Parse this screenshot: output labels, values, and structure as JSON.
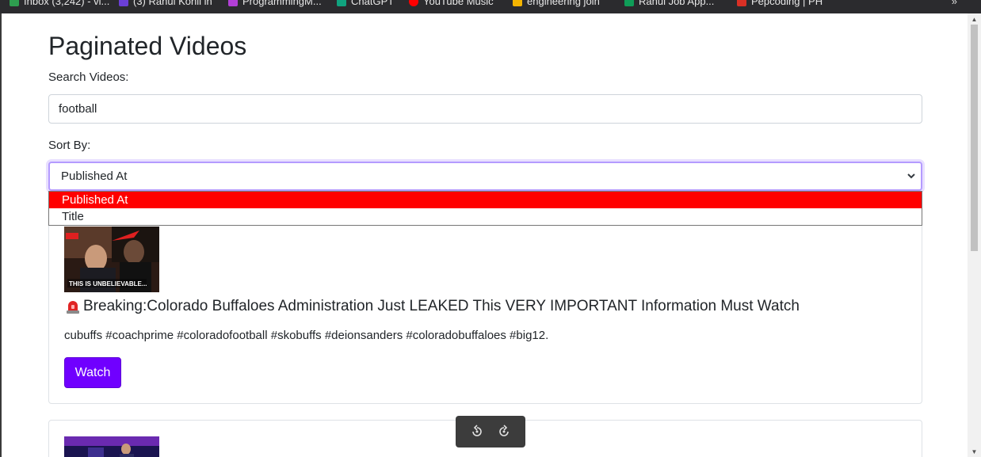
{
  "browser": {
    "bookmarks": [
      {
        "label": "Inbox (3,242) - vi...",
        "color": "#2e9e4f"
      },
      {
        "label": "(3) Rahul Kohli in",
        "color": "#6b3fd6"
      },
      {
        "label": "ProgrammingM...",
        "color": "#b23fd6"
      },
      {
        "label": "ChatGPT",
        "color": "#10a37f"
      },
      {
        "label": "YouTube Music",
        "color": "#ff0000"
      },
      {
        "label": "engineering join",
        "color": "#f4b400"
      },
      {
        "label": "Rahul Job App...",
        "color": "#0f9d58"
      },
      {
        "label": "Pepcoding | PH",
        "color": "#d93025"
      }
    ]
  },
  "page": {
    "title": "Paginated Videos"
  },
  "search": {
    "label": "Search Videos:",
    "value": "football"
  },
  "sort": {
    "label": "Sort By:",
    "selected": "Published At",
    "options": [
      "Published At",
      "Title"
    ]
  },
  "videos": [
    {
      "thumb_caption": "THIS IS UNBELIEVABLE...",
      "title": "Breaking:Colorado Buffaloes Administration Just LEAKED This VERY IMPORTANT Information Must Watch",
      "description": "cubuffs #coachprime #coloradofootball #skobuffs #deionsanders #coloradobuffaloes #big12.",
      "watch_label": "Watch"
    }
  ],
  "media_controls": {
    "icons": [
      "rewind-icon",
      "forward-icon"
    ]
  },
  "colors": {
    "accent": "#7000ff",
    "selected_option": "#ff0000",
    "focus_ring": "#b49bff"
  }
}
